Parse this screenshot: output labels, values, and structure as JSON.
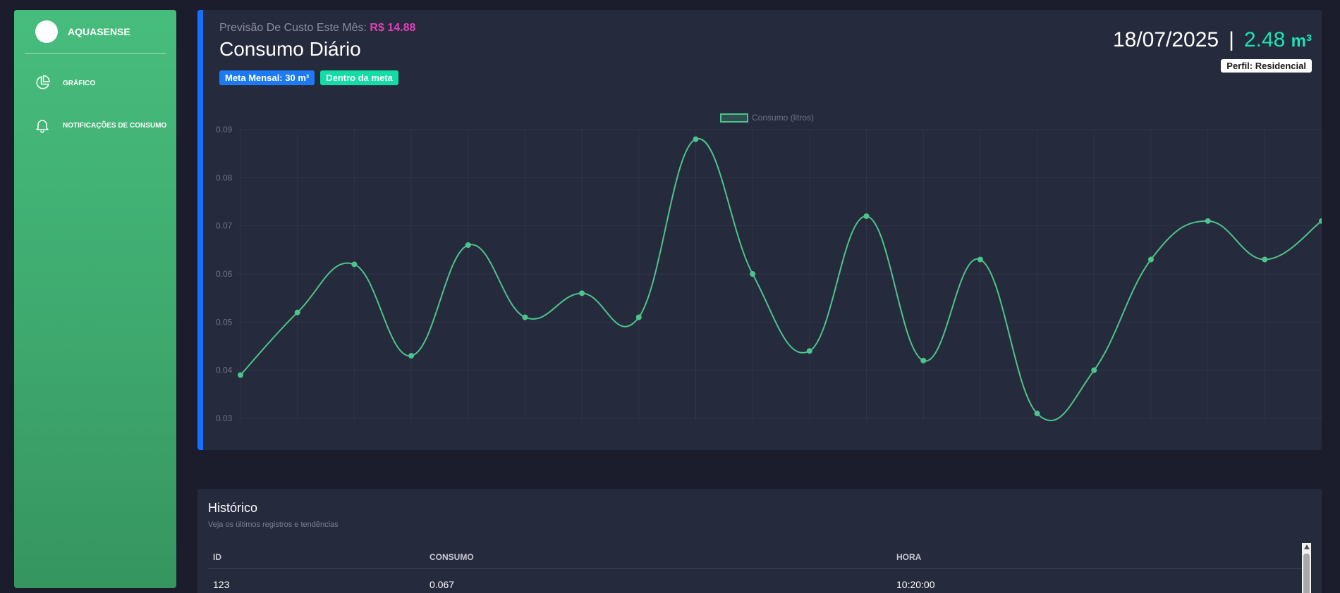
{
  "sidebar": {
    "brand": "AQUASENSE",
    "items": [
      {
        "label": "Gráfico",
        "icon": "pie-chart-icon"
      },
      {
        "label": "Notificações de Consumo",
        "icon": "bell-icon"
      }
    ]
  },
  "header": {
    "forecast_label": "Previsão De Custo Este Mês:",
    "forecast_value": "R$ 14.88",
    "title": "Consumo Diário",
    "badge_goal": "Meta Mensal: 30 m³",
    "badge_status": "Dentro da meta",
    "date": "18/07/2025",
    "separator": "|",
    "reading": "2.48",
    "unit": "m³",
    "profile": "Perfil: Residencial"
  },
  "colors": {
    "accent_blue": "#1570ff",
    "sidebar_green": "#47bd7d",
    "line_green": "#4cc48b",
    "reading_teal": "#1be4b2",
    "forecast_pink": "#e040b8"
  },
  "chart_data": {
    "type": "line",
    "series": [
      {
        "name": "Consumo (litros)",
        "values": [
          0.039,
          0.052,
          0.062,
          0.043,
          0.066,
          0.051,
          0.056,
          0.051,
          0.088,
          0.06,
          0.044,
          0.072,
          0.042,
          0.063,
          0.031,
          0.04,
          0.063,
          0.071,
          0.063,
          0.071
        ]
      }
    ],
    "yticks": [
      "0.03",
      "0.04",
      "0.05",
      "0.06",
      "0.07",
      "0.08",
      "0.09"
    ],
    "ylim": [
      0.03,
      0.09
    ],
    "grid": true,
    "legend": "top-center"
  },
  "history": {
    "title": "Histórico",
    "subtitle": "Veja os últimos registros e tendências",
    "columns": [
      "ID",
      "CONSUMO",
      "HORA"
    ],
    "rows": [
      [
        "123",
        "0.067",
        "10:20:00"
      ]
    ]
  }
}
